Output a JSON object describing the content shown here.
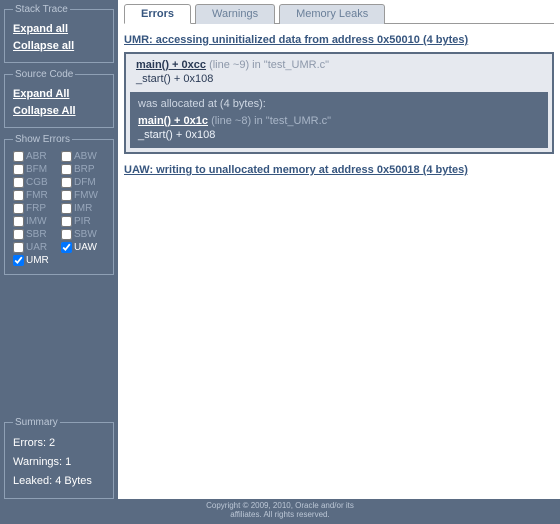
{
  "sidebar": {
    "stack_trace": {
      "legend": "Stack Trace",
      "expand": "Expand all",
      "collapse": "Collapse all"
    },
    "source_code": {
      "legend": "Source Code",
      "expand": "Expand All",
      "collapse": "Collapse All"
    },
    "show_errors": {
      "legend": "Show Errors",
      "items": [
        {
          "code": "ABR",
          "checked": false,
          "active": false
        },
        {
          "code": "ABW",
          "checked": false,
          "active": false
        },
        {
          "code": "BFM",
          "checked": false,
          "active": false
        },
        {
          "code": "BRP",
          "checked": false,
          "active": false
        },
        {
          "code": "CGB",
          "checked": false,
          "active": false
        },
        {
          "code": "DFM",
          "checked": false,
          "active": false
        },
        {
          "code": "FMR",
          "checked": false,
          "active": false
        },
        {
          "code": "FMW",
          "checked": false,
          "active": false
        },
        {
          "code": "FRP",
          "checked": false,
          "active": false
        },
        {
          "code": "IMR",
          "checked": false,
          "active": false
        },
        {
          "code": "IMW",
          "checked": false,
          "active": false
        },
        {
          "code": "PIR",
          "checked": false,
          "active": false
        },
        {
          "code": "SBR",
          "checked": false,
          "active": false
        },
        {
          "code": "SBW",
          "checked": false,
          "active": false
        },
        {
          "code": "UAR",
          "checked": false,
          "active": false
        },
        {
          "code": "UAW",
          "checked": true,
          "active": true
        },
        {
          "code": "UMR",
          "checked": true,
          "active": true
        }
      ]
    },
    "summary": {
      "legend": "Summary",
      "errors": "Errors: 2",
      "warnings": "Warnings: 1",
      "leaked": "Leaked: 4 Bytes"
    }
  },
  "tabs": {
    "errors": "Errors",
    "warnings": "Warnings",
    "memleaks": "Memory Leaks"
  },
  "entries": {
    "umr": {
      "header_text": "UMR: accessing uninitialized data from address 0x50010 (4 bytes)",
      "line1_a": "main() + 0xcc",
      "line1_b": " (line ~9) in \"test_UMR.c\"",
      "line2": "_start() + 0x108",
      "alloc_title": "was allocated at (4 bytes):",
      "alloc1_a": "main() + 0x1c",
      "alloc1_b": " (line ~8) in \"test_UMR.c\"",
      "alloc2": "_start() + 0x108"
    },
    "uaw": {
      "header_text": "UAW: writing to unallocated memory at address 0x50018 (4 bytes)"
    }
  },
  "footer": {
    "line1": "Copyright © 2009, 2010, Oracle and/or its",
    "line2": "affiliates. All rights reserved."
  }
}
